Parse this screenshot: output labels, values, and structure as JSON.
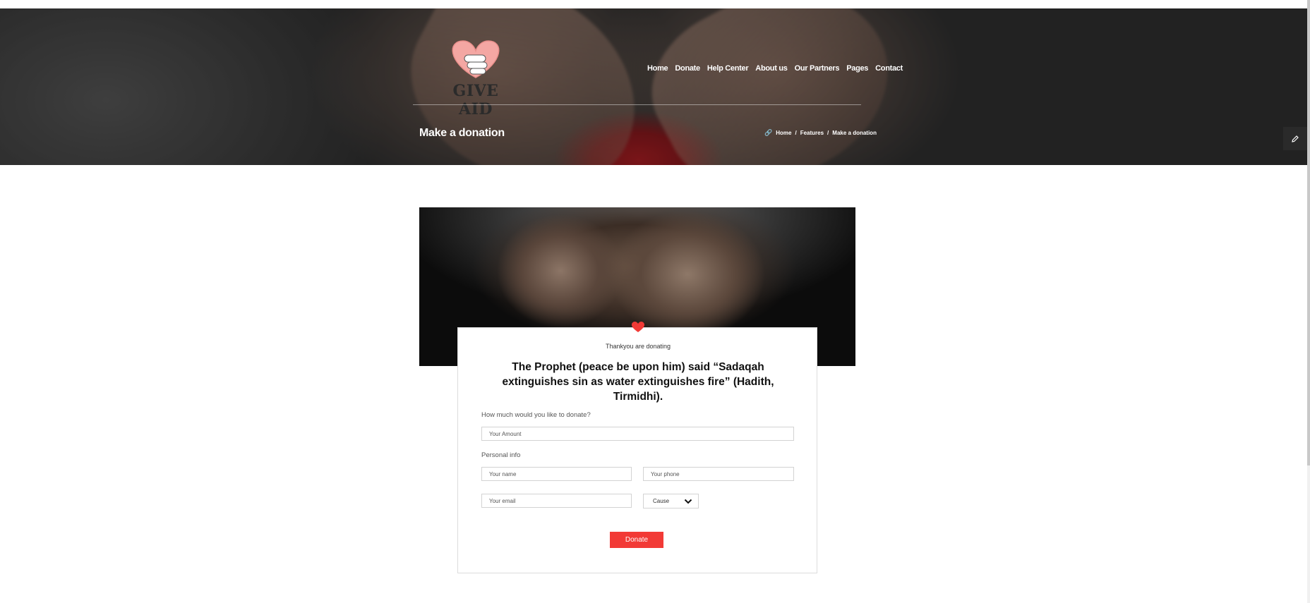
{
  "brand": {
    "logo_text": "GIVE AID",
    "accent": "#f23a36"
  },
  "nav": {
    "items": [
      {
        "label": "Home"
      },
      {
        "label": "Donate"
      },
      {
        "label": "Help Center"
      },
      {
        "label": "About us"
      },
      {
        "label": "Our Partners"
      },
      {
        "label": "Pages"
      },
      {
        "label": "Contact"
      }
    ]
  },
  "hero": {
    "title": "Make a donation",
    "breadcrumb": [
      "Home",
      "Features",
      "Make a donation"
    ],
    "separator": "/"
  },
  "side_tab": {
    "icon": "pencil-icon"
  },
  "form": {
    "subtitle": "Thankyou are donating",
    "quote": "The Prophet (peace be upon him) said “Sadaqah extinguishes sin as water extinguishes fire” (Hadith, Tirmidhi).",
    "amount_label": "How much would you like to donate?",
    "amount_placeholder": "Your Amount",
    "personal_label": "Personal info",
    "name_placeholder": "Your name",
    "phone_placeholder": "Your phone",
    "email_placeholder": "Your email",
    "cause_selected": "Cause",
    "submit_label": "Donate"
  }
}
